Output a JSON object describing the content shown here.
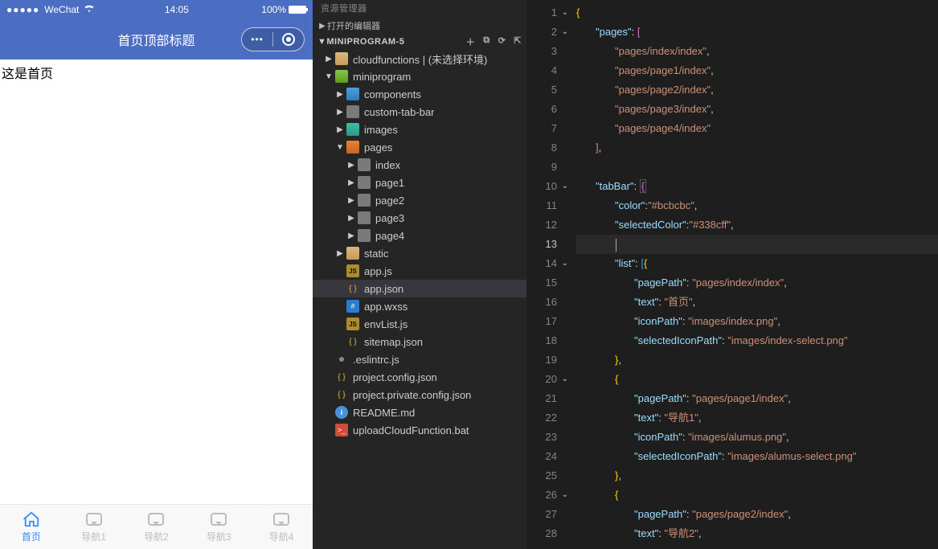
{
  "phone": {
    "statusbar": {
      "signal": "●●●●●",
      "carrier": "WeChat",
      "wifi_icon": "wifi-icon",
      "time": "14:05",
      "battery_pct": "100%"
    },
    "navbar": {
      "title": "首页顶部标题",
      "menu_icon": "more-icon",
      "target_icon": "target-icon"
    },
    "body_text": "这是首页",
    "tabs": [
      {
        "label": "首页",
        "icon": "home-icon",
        "active": true
      },
      {
        "label": "导航1",
        "icon": "chat-icon",
        "active": false
      },
      {
        "label": "导航2",
        "icon": "chat-icon",
        "active": false
      },
      {
        "label": "导航3",
        "icon": "chat-icon",
        "active": false
      },
      {
        "label": "导航4",
        "icon": "chat-icon",
        "active": false
      }
    ]
  },
  "explorer": {
    "panel_label": "资源管理器",
    "collapsed_section": "打开的编辑器",
    "root": "MINIPROGRAM-5",
    "action_icons": [
      "new-file-icon",
      "new-folder-icon",
      "refresh-icon",
      "collapse-all-icon"
    ],
    "tree": {
      "cloudfunctions": "cloudfunctions | (未选择环境)",
      "miniprogram": {
        "label": "miniprogram",
        "children": {
          "components": "components",
          "custom_tab_bar": "custom-tab-bar",
          "images": "images",
          "pages": {
            "label": "pages",
            "children": [
              "index",
              "page1",
              "page2",
              "page3",
              "page4"
            ]
          },
          "static": "static",
          "app_js": "app.js",
          "app_json": "app.json",
          "app_wxss": "app.wxss",
          "envlist": "envList.js",
          "sitemap": "sitemap.json"
        }
      },
      "eslintrc": ".eslintrc.js",
      "project_config": "project.config.json",
      "project_private": "project.private.config.json",
      "readme": "README.md",
      "upload_bat": "uploadCloudFunction.bat"
    }
  },
  "editor": {
    "current_line": 13,
    "lines": [
      {
        "n": 1,
        "fold": "v",
        "ind": 0,
        "tokens": [
          [
            "brace-y",
            "{"
          ]
        ]
      },
      {
        "n": 2,
        "fold": "v",
        "ind": 1,
        "tokens": [
          [
            "key",
            "\"pages\""
          ],
          [
            "punc",
            ": "
          ],
          [
            "brace-p",
            "["
          ]
        ]
      },
      {
        "n": 3,
        "ind": 2,
        "tokens": [
          [
            "str",
            "\"pages/index/index\""
          ],
          [
            "punc",
            ","
          ]
        ]
      },
      {
        "n": 4,
        "ind": 2,
        "tokens": [
          [
            "str",
            "\"pages/page1/index\""
          ],
          [
            "punc",
            ","
          ]
        ]
      },
      {
        "n": 5,
        "ind": 2,
        "tokens": [
          [
            "str",
            "\"pages/page2/index\""
          ],
          [
            "punc",
            ","
          ]
        ]
      },
      {
        "n": 6,
        "ind": 2,
        "tokens": [
          [
            "str",
            "\"pages/page3/index\""
          ],
          [
            "punc",
            ","
          ]
        ]
      },
      {
        "n": 7,
        "ind": 2,
        "tokens": [
          [
            "str",
            "\"pages/page4/index\""
          ]
        ]
      },
      {
        "n": 8,
        "ind": 1,
        "tokens": [
          [
            "brace-p",
            "]"
          ],
          [
            "punc",
            ","
          ]
        ]
      },
      {
        "n": 9,
        "ind": 0,
        "tokens": []
      },
      {
        "n": 10,
        "fold": "v",
        "ind": 1,
        "tokens": [
          [
            "key",
            "\"tabBar\""
          ],
          [
            "punc",
            ": "
          ],
          [
            "brace-p-box",
            "{"
          ]
        ]
      },
      {
        "n": 11,
        "ind": 2,
        "tokens": [
          [
            "key",
            "\"color\""
          ],
          [
            "punc",
            ":"
          ],
          [
            "str",
            "\"#bcbcbc\""
          ],
          [
            "punc",
            ","
          ]
        ]
      },
      {
        "n": 12,
        "ind": 2,
        "tokens": [
          [
            "key",
            "\"selectedColor\""
          ],
          [
            "punc",
            ":"
          ],
          [
            "str",
            "\"#338cff\""
          ],
          [
            "punc",
            ","
          ]
        ]
      },
      {
        "n": 13,
        "ind": 2,
        "tokens": [],
        "current": true
      },
      {
        "n": 14,
        "fold": "v",
        "ind": 2,
        "tokens": [
          [
            "key",
            "\"list\""
          ],
          [
            "punc",
            ": "
          ],
          [
            "brace-b",
            "["
          ],
          [
            "brace-y",
            "{"
          ]
        ]
      },
      {
        "n": 15,
        "ind": 3,
        "tokens": [
          [
            "key",
            "\"pagePath\""
          ],
          [
            "punc",
            ": "
          ],
          [
            "str",
            "\"pages/index/index\""
          ],
          [
            "punc",
            ","
          ]
        ]
      },
      {
        "n": 16,
        "ind": 3,
        "tokens": [
          [
            "key",
            "\"text\""
          ],
          [
            "punc",
            ": "
          ],
          [
            "str",
            "\"首页\""
          ],
          [
            "punc",
            ","
          ]
        ]
      },
      {
        "n": 17,
        "ind": 3,
        "tokens": [
          [
            "key",
            "\"iconPath\""
          ],
          [
            "punc",
            ": "
          ],
          [
            "str",
            "\"images/index.png\""
          ],
          [
            "punc",
            ","
          ]
        ]
      },
      {
        "n": 18,
        "ind": 3,
        "tokens": [
          [
            "key",
            "\"selectedIconPath\""
          ],
          [
            "punc",
            ": "
          ],
          [
            "str",
            "\"images/index-select.png\""
          ]
        ]
      },
      {
        "n": 19,
        "ind": 2,
        "tokens": [
          [
            "brace-y",
            "}"
          ],
          [
            "punc",
            ","
          ]
        ]
      },
      {
        "n": 20,
        "fold": "v",
        "ind": 2,
        "tokens": [
          [
            "brace-y",
            "{"
          ]
        ]
      },
      {
        "n": 21,
        "ind": 3,
        "tokens": [
          [
            "key",
            "\"pagePath\""
          ],
          [
            "punc",
            ": "
          ],
          [
            "str",
            "\"pages/page1/index\""
          ],
          [
            "punc",
            ","
          ]
        ]
      },
      {
        "n": 22,
        "ind": 3,
        "tokens": [
          [
            "key",
            "\"text\""
          ],
          [
            "punc",
            ": "
          ],
          [
            "str",
            "\"导航1\""
          ],
          [
            "punc",
            ","
          ]
        ]
      },
      {
        "n": 23,
        "ind": 3,
        "tokens": [
          [
            "key",
            "\"iconPath\""
          ],
          [
            "punc",
            ": "
          ],
          [
            "str",
            "\"images/alumus.png\""
          ],
          [
            "punc",
            ","
          ]
        ]
      },
      {
        "n": 24,
        "ind": 3,
        "tokens": [
          [
            "key",
            "\"selectedIconPath\""
          ],
          [
            "punc",
            ": "
          ],
          [
            "str",
            "\"images/alumus-select.png\""
          ]
        ]
      },
      {
        "n": 25,
        "ind": 2,
        "tokens": [
          [
            "brace-y",
            "}"
          ],
          [
            "punc",
            ","
          ]
        ]
      },
      {
        "n": 26,
        "fold": "v",
        "ind": 2,
        "tokens": [
          [
            "brace-y",
            "{"
          ]
        ]
      },
      {
        "n": 27,
        "ind": 3,
        "tokens": [
          [
            "key",
            "\"pagePath\""
          ],
          [
            "punc",
            ": "
          ],
          [
            "str",
            "\"pages/page2/index\""
          ],
          [
            "punc",
            ","
          ]
        ]
      },
      {
        "n": 28,
        "ind": 3,
        "tokens": [
          [
            "key",
            "\"text\""
          ],
          [
            "punc",
            ": "
          ],
          [
            "str",
            "\"导航2\""
          ],
          [
            "punc",
            ","
          ]
        ]
      }
    ]
  }
}
